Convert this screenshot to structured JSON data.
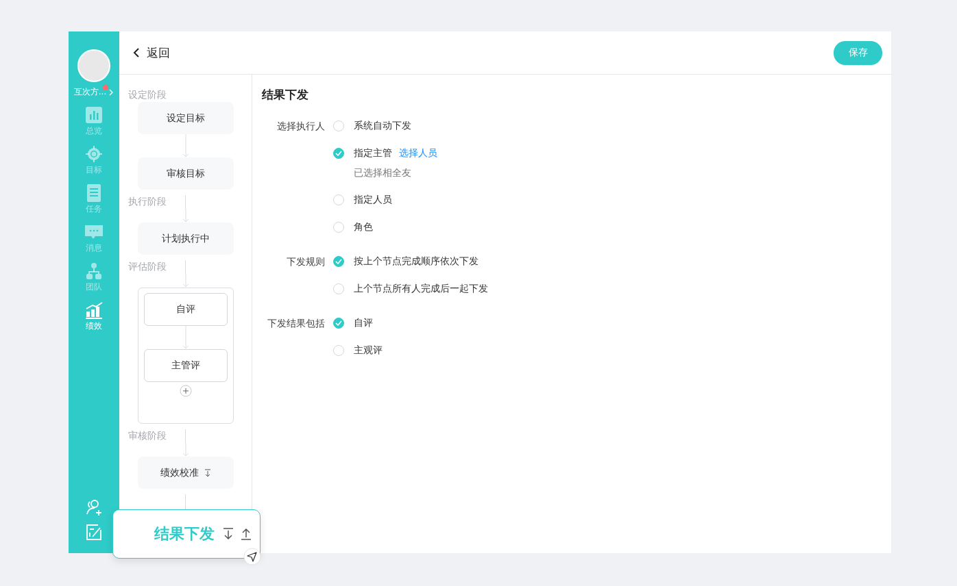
{
  "sidebar": {
    "user": {
      "name": "互次方...",
      "unread": true
    },
    "nav": [
      {
        "label": "总览",
        "selected": false
      },
      {
        "label": "目标",
        "selected": false
      },
      {
        "label": "任务",
        "selected": false
      },
      {
        "label": "消息",
        "selected": false
      },
      {
        "label": "团队",
        "selected": false
      },
      {
        "label": "绩效",
        "selected": true
      }
    ]
  },
  "header": {
    "back": "返回",
    "save": "保存"
  },
  "flow": {
    "stages": [
      {
        "title": "设定阶段",
        "kind": "plain",
        "nodes": [
          {
            "label": "设定目标",
            "kind": "node"
          },
          {
            "label": "审核目标",
            "kind": "node"
          }
        ]
      },
      {
        "title": "执行阶段",
        "kind": "plain",
        "nodes": [
          {
            "label": "计划执行中",
            "kind": "node"
          }
        ]
      },
      {
        "title": "评估阶段",
        "kind": "group",
        "nodes": [
          {
            "label": "自评",
            "kind": "node"
          },
          {
            "label": "主管评",
            "kind": "node"
          }
        ]
      },
      {
        "title": "审核阶段",
        "kind": "plain",
        "nodes": [
          {
            "label": "绩效校准",
            "kind": "sortable"
          }
        ]
      }
    ],
    "active_node": {
      "label": "结果下发"
    }
  },
  "panel": {
    "title": "结果下发",
    "groups": [
      {
        "label": "选择执行人",
        "options": [
          {
            "label": "系统自动下发",
            "selected": false
          },
          {
            "label": "指定主管",
            "selected": true,
            "link": "选择人员",
            "note": "已选择相全友"
          },
          {
            "label": "指定人员",
            "selected": false
          },
          {
            "label": "角色",
            "selected": false
          }
        ]
      },
      {
        "label": "下发规则",
        "options": [
          {
            "label": "按上个节点完成顺序依次下发",
            "selected": true
          },
          {
            "label": "上个节点所有人完成后一起下发",
            "selected": false
          }
        ]
      },
      {
        "label": "下发结果包括",
        "options": [
          {
            "label": "自评",
            "selected": true
          },
          {
            "label": "主观评",
            "selected": false
          }
        ]
      }
    ]
  }
}
